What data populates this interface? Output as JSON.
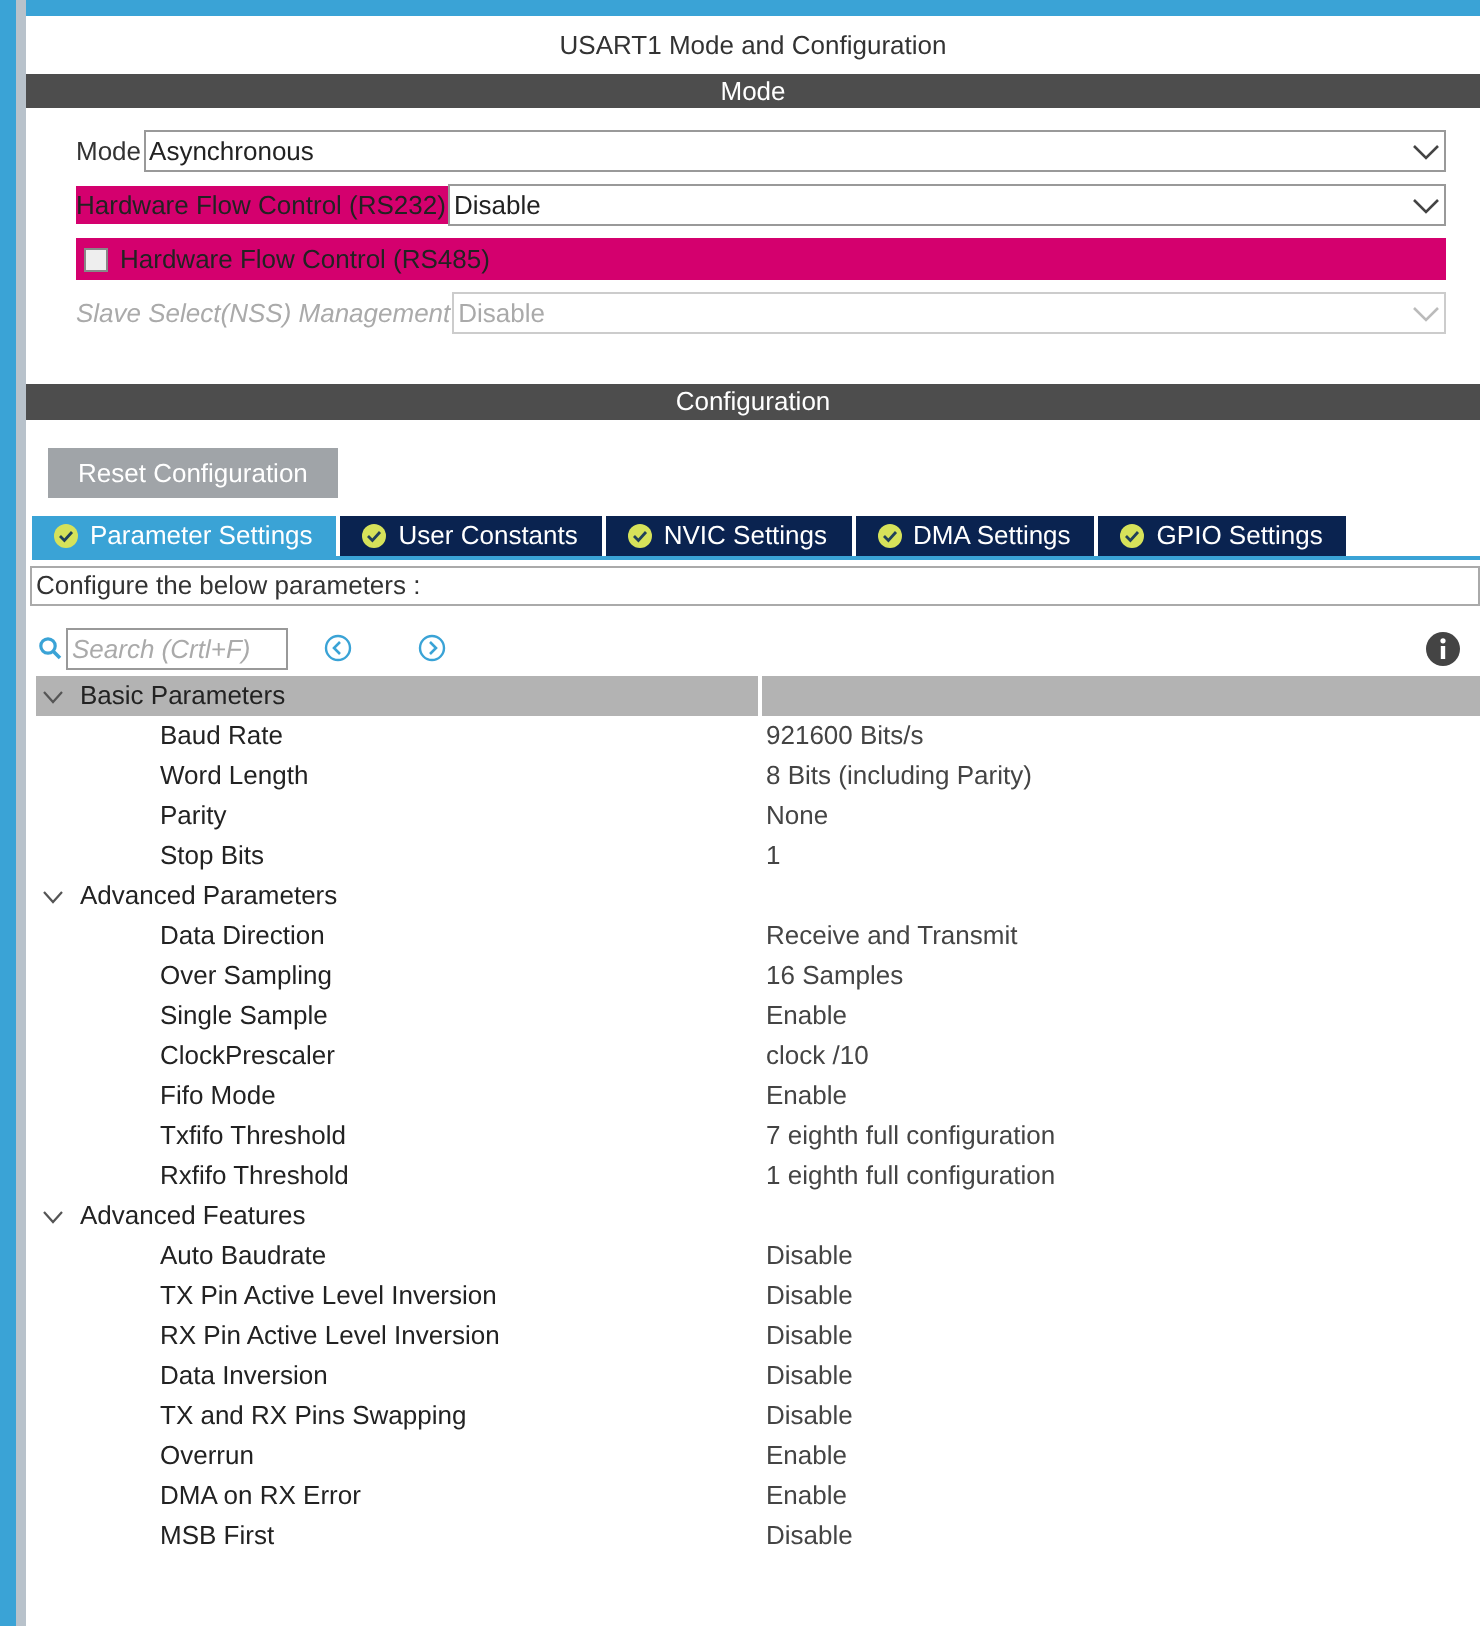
{
  "window": {
    "title": "USART1 Mode and Configuration"
  },
  "mode": {
    "header": "Mode",
    "fields": [
      {
        "kind": "select",
        "label": "Mode",
        "value": "Asynchronous",
        "highlighted": false,
        "disabled": false
      },
      {
        "kind": "select",
        "label": "Hardware Flow Control (RS232)",
        "value": "Disable",
        "highlighted": true,
        "disabled": false
      },
      {
        "kind": "checkbox",
        "label": "Hardware Flow Control (RS485)",
        "checked": false,
        "highlighted": true,
        "disabled": false
      },
      {
        "kind": "select",
        "label": "Slave Select(NSS) Management",
        "value": "Disable",
        "highlighted": false,
        "disabled": true
      }
    ]
  },
  "configuration": {
    "header": "Configuration",
    "reset_button": "Reset Configuration",
    "tabs": [
      {
        "label": "Parameter Settings",
        "selected": true
      },
      {
        "label": "User Constants",
        "selected": false
      },
      {
        "label": "NVIC Settings",
        "selected": false
      },
      {
        "label": "DMA Settings",
        "selected": false
      },
      {
        "label": "GPIO Settings",
        "selected": false
      }
    ],
    "description": "Configure the below parameters :",
    "search": {
      "placeholder": "Search (Crtl+F)"
    },
    "groups": [
      {
        "name": "Basic Parameters",
        "expanded": true,
        "selected": true,
        "params": [
          {
            "name": "Baud Rate",
            "value": "921600 Bits/s"
          },
          {
            "name": "Word Length",
            "value": "8 Bits (including Parity)"
          },
          {
            "name": "Parity",
            "value": "None"
          },
          {
            "name": "Stop Bits",
            "value": "1"
          }
        ]
      },
      {
        "name": "Advanced Parameters",
        "expanded": true,
        "selected": false,
        "params": [
          {
            "name": "Data Direction",
            "value": "Receive and Transmit"
          },
          {
            "name": "Over Sampling",
            "value": "16 Samples"
          },
          {
            "name": "Single Sample",
            "value": "Enable"
          },
          {
            "name": "ClockPrescaler",
            "value": "clock /10"
          },
          {
            "name": "Fifo Mode",
            "value": "Enable"
          },
          {
            "name": "Txfifo Threshold",
            "value": "7 eighth full configuration"
          },
          {
            "name": "Rxfifo Threshold",
            "value": "1 eighth full configuration"
          }
        ]
      },
      {
        "name": "Advanced Features",
        "expanded": true,
        "selected": false,
        "params": [
          {
            "name": "Auto Baudrate",
            "value": "Disable"
          },
          {
            "name": "TX Pin Active Level Inversion",
            "value": "Disable"
          },
          {
            "name": "RX Pin Active Level Inversion",
            "value": "Disable"
          },
          {
            "name": "Data Inversion",
            "value": "Disable"
          },
          {
            "name": "TX and RX Pins Swapping",
            "value": "Disable"
          },
          {
            "name": "Overrun",
            "value": "Enable"
          },
          {
            "name": "DMA on RX Error",
            "value": "Enable"
          },
          {
            "name": "MSB First",
            "value": "Disable"
          }
        ]
      }
    ]
  }
}
